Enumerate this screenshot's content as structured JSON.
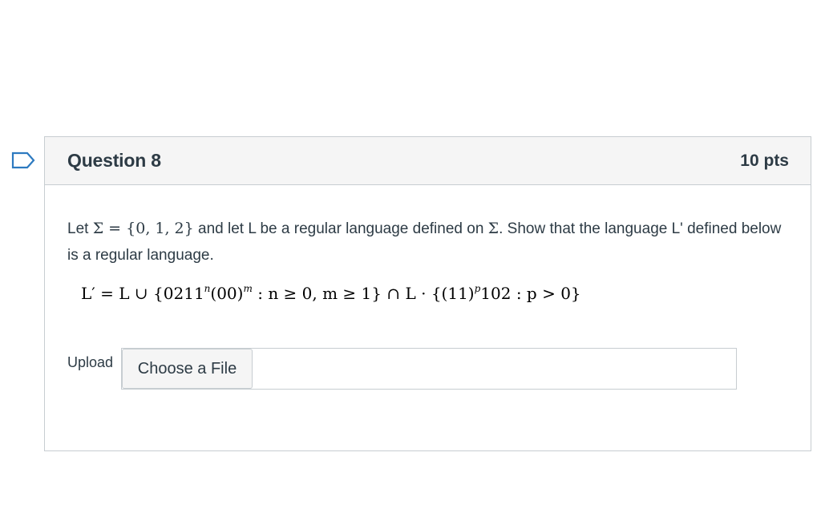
{
  "question": {
    "title": "Question 8",
    "points": "10 pts",
    "text": {
      "part1": "Let ",
      "sigma_set": "Σ = {0, 1, 2}",
      "part2": " and let L be a regular language defined on ",
      "sigma": "Σ",
      "part3": ". Show that the language L' defined below is a regular language."
    },
    "formula": {
      "lhs": "L′ = L ∪ {0211",
      "exp_n": "n",
      "mid1": "(00)",
      "exp_m": "m",
      "mid2": " : n ≥ 0, m ≥ 1} ∩ L · {(11)",
      "exp_p": "p",
      "rhs": "102 : p > 0}"
    },
    "upload": {
      "label": "Upload",
      "button_label": "Choose a File"
    }
  },
  "colors": {
    "text": "#2d3b45",
    "header_bg": "#f5f5f5",
    "border": "#c7cdd1",
    "bookmark": "#2d7ac0"
  },
  "icons": {
    "bookmark": "bookmark-flag-icon"
  }
}
